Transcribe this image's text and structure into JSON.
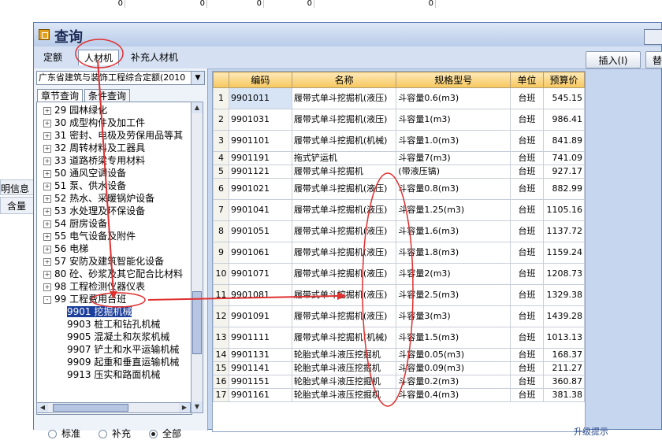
{
  "background": {
    "top_values": [
      "0",
      "0",
      "0",
      "0",
      "0"
    ],
    "left_labels": [
      "明信息",
      "含量"
    ]
  },
  "window": {
    "title": "查询",
    "tabs": [
      "定额",
      "人材机",
      "补充人材机"
    ],
    "buttons": {
      "insert": "插入(I)",
      "replace": "替"
    }
  },
  "left": {
    "dropdown": "广东省建筑与装饰工程综合定额(2010",
    "subtabs": [
      "章节查询",
      "条件查询"
    ],
    "tree": [
      {
        "label": "29  园林绿化",
        "toggle": "+"
      },
      {
        "label": "30  成型构件及加工件",
        "toggle": "+"
      },
      {
        "label": "31  密封、电极及劳保用品等其",
        "toggle": "+"
      },
      {
        "label": "32  周转材料及工器具",
        "toggle": "+"
      },
      {
        "label": "33  道路桥梁专用材料",
        "toggle": "+"
      },
      {
        "label": "50  通风空调设备",
        "toggle": "+"
      },
      {
        "label": "51  泵、供水设备",
        "toggle": "+"
      },
      {
        "label": "52  热水、采暖锅炉设备",
        "toggle": "+"
      },
      {
        "label": "53  水处理及环保设备",
        "toggle": "+"
      },
      {
        "label": "54  厨房设备",
        "toggle": "+"
      },
      {
        "label": "55  电气设备及附件",
        "toggle": "+"
      },
      {
        "label": "56  电梯",
        "toggle": "+"
      },
      {
        "label": "57  安防及建筑智能化设备",
        "toggle": "+"
      },
      {
        "label": "80  砼、砂浆及其它配合比材料",
        "toggle": "+"
      },
      {
        "label": "98  工程检测仪器仪表",
        "toggle": "+"
      },
      {
        "label": "99  工程费用台班",
        "toggle": "-"
      }
    ],
    "subtree": [
      "9901  挖掘机械",
      "9903  桩工和钻孔机械",
      "9905  混凝土和灰浆机械",
      "9907  铲土和水平运输机械",
      "9909  起重和垂直运输机械",
      "9913  压实和路面机械"
    ],
    "radios": [
      "标准",
      "补充",
      "全部"
    ],
    "radio_selected": "全部"
  },
  "table": {
    "headers": [
      "编码",
      "名称",
      "规格型号",
      "单位",
      "预算价"
    ],
    "rows": [
      {
        "n": "1",
        "code": "9901011",
        "name": "履带式单斗挖掘机(液压)",
        "spec": "斗容量0.6(m3)",
        "unit": "台班",
        "price": "545.15"
      },
      {
        "n": "2",
        "code": "9901031",
        "name": "履带式单斗挖掘机(液压)",
        "spec": "斗容量1(m3)",
        "unit": "台班",
        "price": "986.41"
      },
      {
        "n": "3",
        "code": "9901101",
        "name": "履带式单斗挖掘机(机械)",
        "spec": "斗容量1.0(m3)",
        "unit": "台班",
        "price": "841.89"
      },
      {
        "n": "4",
        "code": "9901191",
        "name": "拖式铲运机",
        "spec": "斗容量7(m3)",
        "unit": "台班",
        "price": "741.09"
      },
      {
        "n": "5",
        "code": "9901121",
        "name": "履带式单斗挖掘机",
        "spec": "(带液压镐)",
        "unit": "台班",
        "price": "927.17"
      },
      {
        "n": "6",
        "code": "9901021",
        "name": "履带式单斗挖掘机(液压)",
        "spec": "斗容量0.8(m3)",
        "unit": "台班",
        "price": "882.99"
      },
      {
        "n": "7",
        "code": "9901041",
        "name": "履带式单斗挖掘机(液压)",
        "spec": "斗容量1.25(m3)",
        "unit": "台班",
        "price": "1105.16"
      },
      {
        "n": "8",
        "code": "9901051",
        "name": "履带式单斗挖掘机(液压)",
        "spec": "斗容量1.6(m3)",
        "unit": "台班",
        "price": "1137.72"
      },
      {
        "n": "9",
        "code": "9901061",
        "name": "履带式单斗挖掘机(液压)",
        "spec": "斗容量1.8(m3)",
        "unit": "台班",
        "price": "1159.24"
      },
      {
        "n": "10",
        "code": "9901071",
        "name": "履带式单斗挖掘机(液压)",
        "spec": "斗容量2(m3)",
        "unit": "台班",
        "price": "1208.73"
      },
      {
        "n": "11",
        "code": "9901081",
        "name": "履带式单斗挖掘机(液压)",
        "spec": "斗容量2.5(m3)",
        "unit": "台班",
        "price": "1329.38"
      },
      {
        "n": "12",
        "code": "9901091",
        "name": "履带式单斗挖掘机(液压)",
        "spec": "斗容量3(m3)",
        "unit": "台班",
        "price": "1439.28"
      },
      {
        "n": "13",
        "code": "9901111",
        "name": "履带式单斗挖掘机(机械)",
        "spec": "斗容量1.5(m3)",
        "unit": "台班",
        "price": "1013.13"
      },
      {
        "n": "14",
        "code": "9901131",
        "name": "轮胎式单斗液压挖掘机",
        "spec": "斗容量0.05(m3)",
        "unit": "台班",
        "price": "168.37"
      },
      {
        "n": "15",
        "code": "9901141",
        "name": "轮胎式单斗液压挖掘机",
        "spec": "斗容量0.09(m3)",
        "unit": "台班",
        "price": "211.27"
      },
      {
        "n": "16",
        "code": "9901151",
        "name": "轮胎式单斗液压挖掘机",
        "spec": "斗容量0.2(m3)",
        "unit": "台班",
        "price": "360.87"
      },
      {
        "n": "17",
        "code": "9901161",
        "name": "轮胎式单斗液压挖掘机",
        "spec": "斗容量0.4(m3)",
        "unit": "台班",
        "price": "381.38"
      }
    ]
  },
  "status": "升级提示"
}
